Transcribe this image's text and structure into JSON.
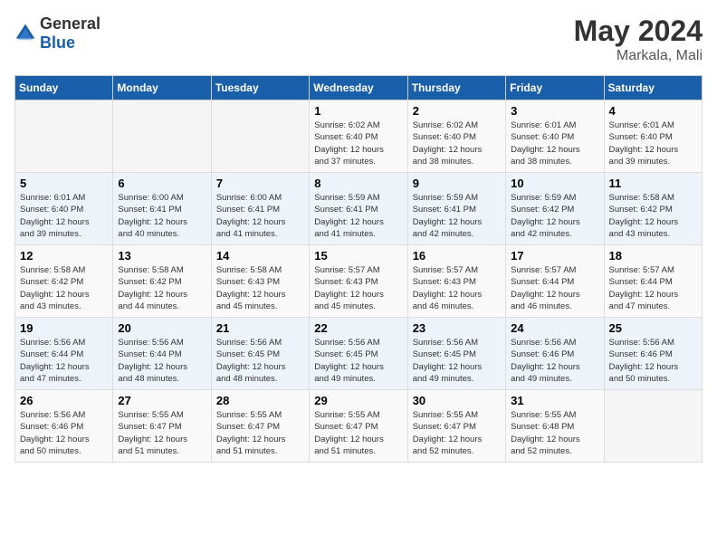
{
  "logo": {
    "general": "General",
    "blue": "Blue"
  },
  "header": {
    "month": "May 2024",
    "location": "Markala, Mali"
  },
  "weekdays": [
    "Sunday",
    "Monday",
    "Tuesday",
    "Wednesday",
    "Thursday",
    "Friday",
    "Saturday"
  ],
  "weeks": [
    [
      {
        "day": "",
        "info": ""
      },
      {
        "day": "",
        "info": ""
      },
      {
        "day": "",
        "info": ""
      },
      {
        "day": "1",
        "info": "Sunrise: 6:02 AM\nSunset: 6:40 PM\nDaylight: 12 hours\nand 37 minutes."
      },
      {
        "day": "2",
        "info": "Sunrise: 6:02 AM\nSunset: 6:40 PM\nDaylight: 12 hours\nand 38 minutes."
      },
      {
        "day": "3",
        "info": "Sunrise: 6:01 AM\nSunset: 6:40 PM\nDaylight: 12 hours\nand 38 minutes."
      },
      {
        "day": "4",
        "info": "Sunrise: 6:01 AM\nSunset: 6:40 PM\nDaylight: 12 hours\nand 39 minutes."
      }
    ],
    [
      {
        "day": "5",
        "info": "Sunrise: 6:01 AM\nSunset: 6:40 PM\nDaylight: 12 hours\nand 39 minutes."
      },
      {
        "day": "6",
        "info": "Sunrise: 6:00 AM\nSunset: 6:41 PM\nDaylight: 12 hours\nand 40 minutes."
      },
      {
        "day": "7",
        "info": "Sunrise: 6:00 AM\nSunset: 6:41 PM\nDaylight: 12 hours\nand 41 minutes."
      },
      {
        "day": "8",
        "info": "Sunrise: 5:59 AM\nSunset: 6:41 PM\nDaylight: 12 hours\nand 41 minutes."
      },
      {
        "day": "9",
        "info": "Sunrise: 5:59 AM\nSunset: 6:41 PM\nDaylight: 12 hours\nand 42 minutes."
      },
      {
        "day": "10",
        "info": "Sunrise: 5:59 AM\nSunset: 6:42 PM\nDaylight: 12 hours\nand 42 minutes."
      },
      {
        "day": "11",
        "info": "Sunrise: 5:58 AM\nSunset: 6:42 PM\nDaylight: 12 hours\nand 43 minutes."
      }
    ],
    [
      {
        "day": "12",
        "info": "Sunrise: 5:58 AM\nSunset: 6:42 PM\nDaylight: 12 hours\nand 43 minutes."
      },
      {
        "day": "13",
        "info": "Sunrise: 5:58 AM\nSunset: 6:42 PM\nDaylight: 12 hours\nand 44 minutes."
      },
      {
        "day": "14",
        "info": "Sunrise: 5:58 AM\nSunset: 6:43 PM\nDaylight: 12 hours\nand 45 minutes."
      },
      {
        "day": "15",
        "info": "Sunrise: 5:57 AM\nSunset: 6:43 PM\nDaylight: 12 hours\nand 45 minutes."
      },
      {
        "day": "16",
        "info": "Sunrise: 5:57 AM\nSunset: 6:43 PM\nDaylight: 12 hours\nand 46 minutes."
      },
      {
        "day": "17",
        "info": "Sunrise: 5:57 AM\nSunset: 6:44 PM\nDaylight: 12 hours\nand 46 minutes."
      },
      {
        "day": "18",
        "info": "Sunrise: 5:57 AM\nSunset: 6:44 PM\nDaylight: 12 hours\nand 47 minutes."
      }
    ],
    [
      {
        "day": "19",
        "info": "Sunrise: 5:56 AM\nSunset: 6:44 PM\nDaylight: 12 hours\nand 47 minutes."
      },
      {
        "day": "20",
        "info": "Sunrise: 5:56 AM\nSunset: 6:44 PM\nDaylight: 12 hours\nand 48 minutes."
      },
      {
        "day": "21",
        "info": "Sunrise: 5:56 AM\nSunset: 6:45 PM\nDaylight: 12 hours\nand 48 minutes."
      },
      {
        "day": "22",
        "info": "Sunrise: 5:56 AM\nSunset: 6:45 PM\nDaylight: 12 hours\nand 49 minutes."
      },
      {
        "day": "23",
        "info": "Sunrise: 5:56 AM\nSunset: 6:45 PM\nDaylight: 12 hours\nand 49 minutes."
      },
      {
        "day": "24",
        "info": "Sunrise: 5:56 AM\nSunset: 6:46 PM\nDaylight: 12 hours\nand 49 minutes."
      },
      {
        "day": "25",
        "info": "Sunrise: 5:56 AM\nSunset: 6:46 PM\nDaylight: 12 hours\nand 50 minutes."
      }
    ],
    [
      {
        "day": "26",
        "info": "Sunrise: 5:56 AM\nSunset: 6:46 PM\nDaylight: 12 hours\nand 50 minutes."
      },
      {
        "day": "27",
        "info": "Sunrise: 5:55 AM\nSunset: 6:47 PM\nDaylight: 12 hours\nand 51 minutes."
      },
      {
        "day": "28",
        "info": "Sunrise: 5:55 AM\nSunset: 6:47 PM\nDaylight: 12 hours\nand 51 minutes."
      },
      {
        "day": "29",
        "info": "Sunrise: 5:55 AM\nSunset: 6:47 PM\nDaylight: 12 hours\nand 51 minutes."
      },
      {
        "day": "30",
        "info": "Sunrise: 5:55 AM\nSunset: 6:47 PM\nDaylight: 12 hours\nand 52 minutes."
      },
      {
        "day": "31",
        "info": "Sunrise: 5:55 AM\nSunset: 6:48 PM\nDaylight: 12 hours\nand 52 minutes."
      },
      {
        "day": "",
        "info": ""
      }
    ]
  ]
}
